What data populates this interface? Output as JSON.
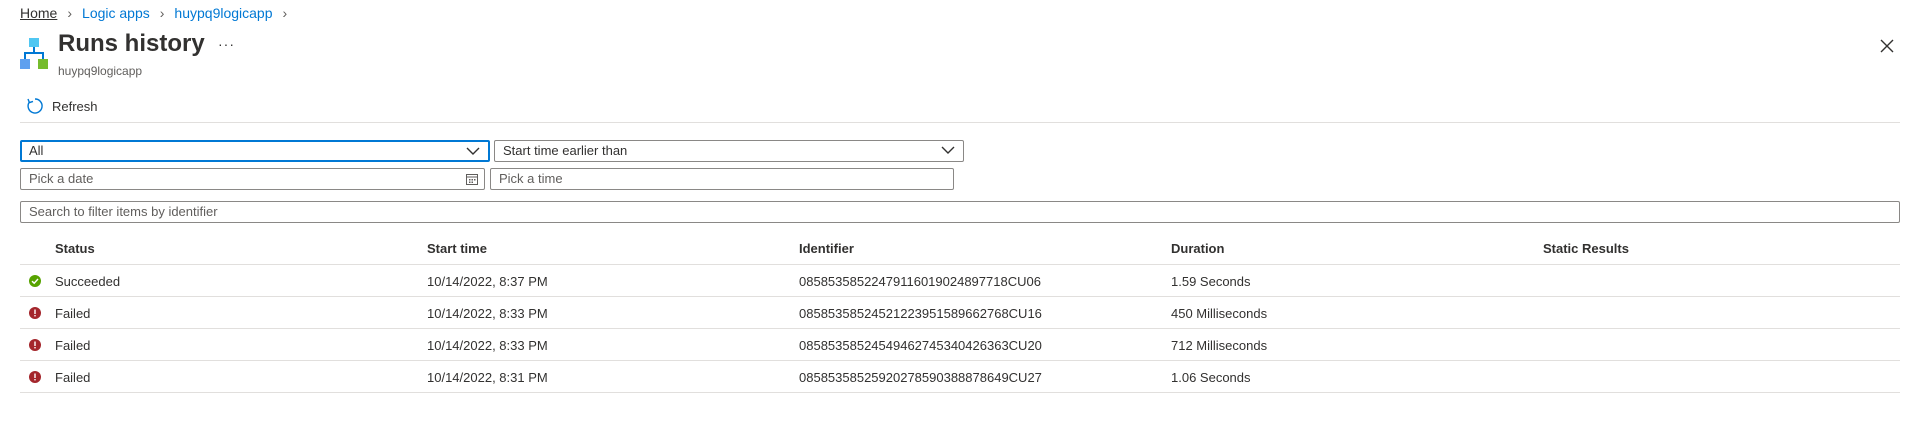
{
  "breadcrumb": {
    "items": [
      "Home",
      "Logic apps",
      "huypq9logicapp"
    ]
  },
  "header": {
    "title": "Runs history",
    "subtitle": "huypq9logicapp",
    "more_label": "···"
  },
  "toolbar": {
    "refresh_label": "Refresh"
  },
  "filters": {
    "status_value": "All",
    "time_filter_value": "Start time earlier than",
    "date_placeholder": "Pick a date",
    "time_placeholder": "Pick a time",
    "search_placeholder": "Search to filter items by identifier"
  },
  "table": {
    "columns": [
      "Status",
      "Start time",
      "Identifier",
      "Duration",
      "Static Results"
    ],
    "rows": [
      {
        "status": "Succeeded",
        "start_time": "10/14/2022, 8:37 PM",
        "identifier": "08585358522479116019024897718CU06",
        "duration": "1.59 Seconds",
        "static_results": ""
      },
      {
        "status": "Failed",
        "start_time": "10/14/2022, 8:33 PM",
        "identifier": "08585358524521223951589662768CU16",
        "duration": "450 Milliseconds",
        "static_results": ""
      },
      {
        "status": "Failed",
        "start_time": "10/14/2022, 8:33 PM",
        "identifier": "08585358524549462745340426363CU20",
        "duration": "712 Milliseconds",
        "static_results": ""
      },
      {
        "status": "Failed",
        "start_time": "10/14/2022, 8:31 PM",
        "identifier": "08585358525920278590388878649CU27",
        "duration": "1.06 Seconds",
        "static_results": ""
      }
    ]
  },
  "colors": {
    "accent": "#0078d4",
    "success": "#57a300",
    "error": "#a4262c"
  }
}
